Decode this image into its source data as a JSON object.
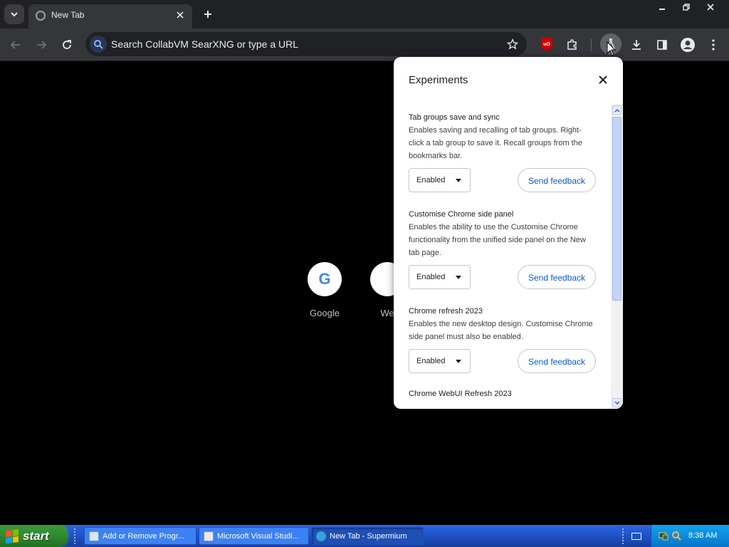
{
  "browser": {
    "tab": {
      "title": "New Tab"
    },
    "omnibox": {
      "placeholder": "Search CollabVM SearXNG or type a URL"
    },
    "extension_badge": "uO"
  },
  "ntp": {
    "shortcuts": [
      {
        "label": "Google",
        "glyph": "G"
      },
      {
        "label": "We",
        "glyph": ""
      }
    ]
  },
  "experiments": {
    "title": "Experiments",
    "items": [
      {
        "title": "Tab groups save and sync",
        "description": "Enables saving and recalling of tab groups. Right-click a tab group to save it. Recall groups from the bookmarks bar.",
        "state": "Enabled",
        "feedback_label": "Send feedback"
      },
      {
        "title": "Customise Chrome side panel",
        "description": "Enables the ability to use the Customise Chrome functionality from the unified side panel on the New tab page.",
        "state": "Enabled",
        "feedback_label": "Send feedback"
      },
      {
        "title": "Chrome refresh 2023",
        "description": "Enables the new desktop design. Customise Chrome side panel must also be enabled.",
        "state": "Enabled",
        "feedback_label": "Send feedback"
      },
      {
        "title": "Chrome WebUI Refresh 2023"
      }
    ]
  },
  "taskbar": {
    "start_label": "start",
    "tasks": [
      {
        "label": "Add or Remove Progr..."
      },
      {
        "label": "Microsoft Visual Studi..."
      },
      {
        "label": "New Tab - Supermium"
      }
    ],
    "clock": "8:38 AM"
  }
}
